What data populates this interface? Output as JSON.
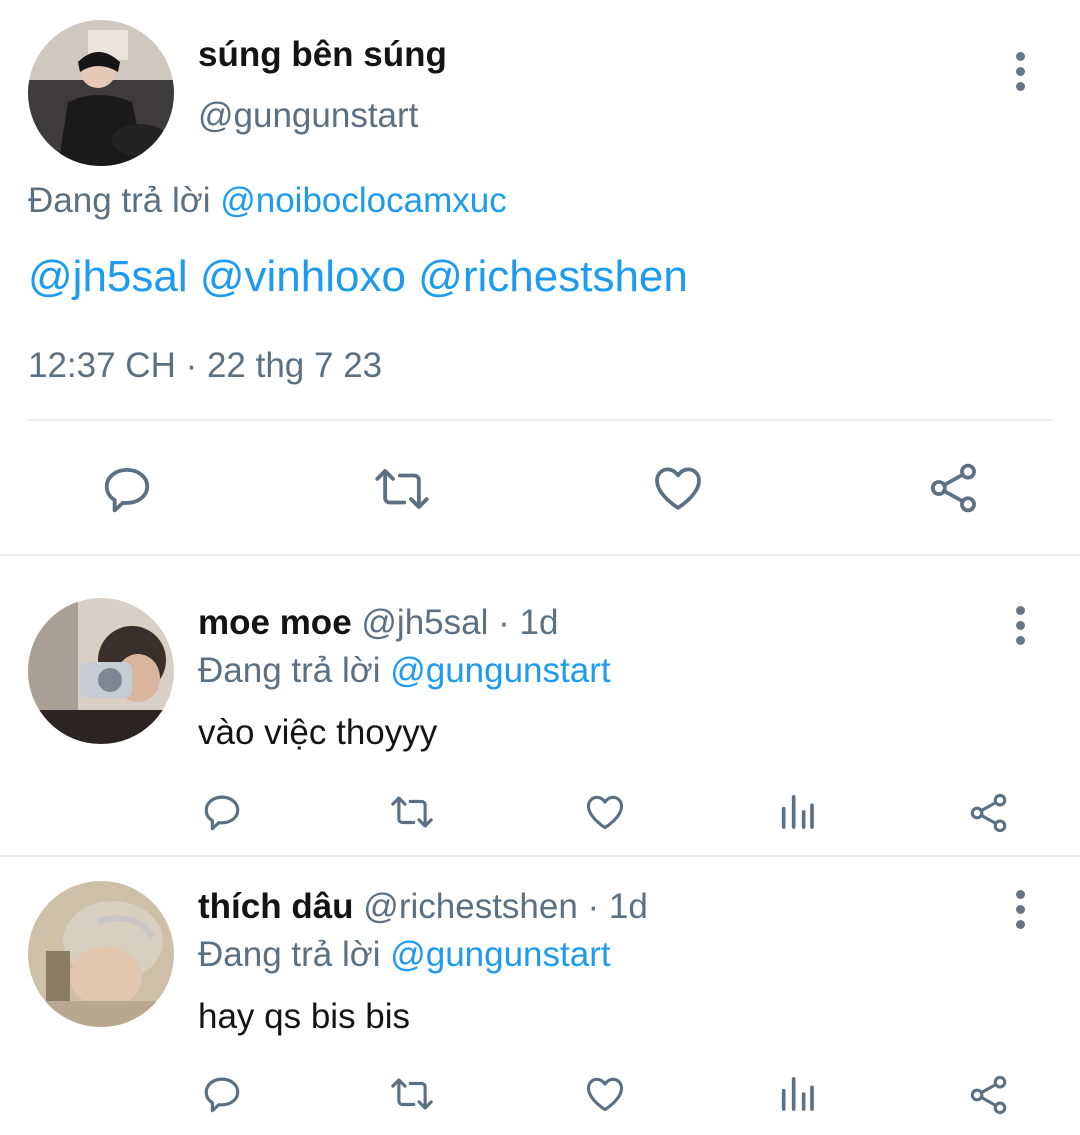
{
  "main_tweet": {
    "display_name": "súng bên súng",
    "handle": "@gungunstart",
    "reply_prefix": "Đang trả lời",
    "reply_to": "@noiboclocamxuc",
    "mentions": "@jh5sal @vinhloxo @richestshen",
    "timestamp": "12:37 CH · 22 thg 7 23",
    "actions": [
      "reply-icon",
      "retweet-icon",
      "like-icon",
      "share-icon"
    ]
  },
  "replies": [
    {
      "display_name": "moe moe",
      "handle": "@jh5sal",
      "age": "· 1d",
      "reply_prefix": "Đang trả lời",
      "reply_to": "@gungunstart",
      "text": "vào việc thoyyy",
      "actions": [
        "reply-icon",
        "retweet-icon",
        "like-icon",
        "analytics-icon",
        "share-icon"
      ]
    },
    {
      "display_name": "thích dâu",
      "handle": "@richestshen",
      "age": "· 1d",
      "reply_prefix": "Đang trả lời",
      "reply_to": "@gungunstart",
      "text": "hay qs bis bis",
      "actions": [
        "reply-icon",
        "retweet-icon",
        "like-icon",
        "analytics-icon",
        "share-icon"
      ]
    }
  ],
  "colors": {
    "link": "#1d9bf0",
    "muted": "#5b7083",
    "icon": "#5b7083",
    "divider": "#e6ecf0"
  }
}
